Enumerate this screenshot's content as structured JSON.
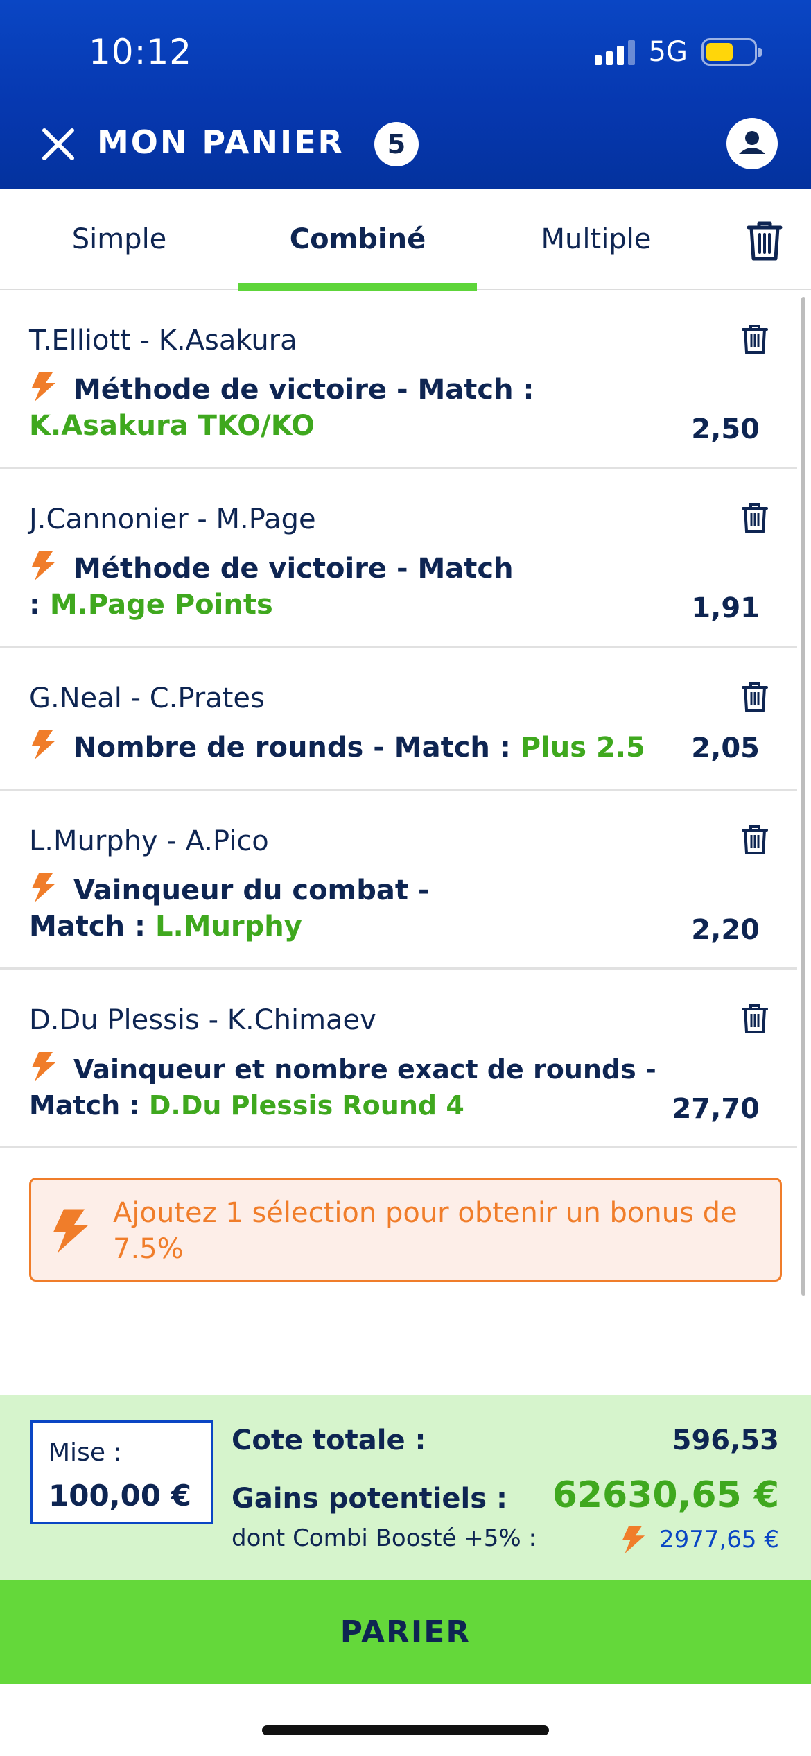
{
  "status_bar": {
    "time": "10:12",
    "network": "5G"
  },
  "header": {
    "title": "MON PANIER",
    "count": "5"
  },
  "tabs": [
    {
      "label": "Simple",
      "active": false
    },
    {
      "label": "Combiné",
      "active": true
    },
    {
      "label": "Multiple",
      "active": false
    }
  ],
  "bets": [
    {
      "match": "T.Elliott - K.Asakura",
      "market": "Méthode de victoire - Match : ",
      "selection": "K.Asakura TKO/KO",
      "odds": "2,50"
    },
    {
      "match": "J.Cannonier - M.Page",
      "market": "Méthode de victoire - Match : ",
      "selection": "M.Page Points",
      "odds": "1,91"
    },
    {
      "match": "G.Neal - C.Prates",
      "market": "Nombre de rounds - Match : ",
      "selection": "Plus 2.5",
      "odds": "2,05"
    },
    {
      "match": "L.Murphy - A.Pico",
      "market": "Vainqueur du combat - Match : ",
      "selection": "L.Murphy",
      "odds": "2,20"
    },
    {
      "match": "D.Du Plessis - K.Chimaev",
      "market": "Vainqueur et nombre exact de rounds - Match : ",
      "selection": "D.Du Plessis Round 4",
      "odds": "27,70"
    }
  ],
  "bonus_banner": {
    "text": "Ajoutez 1 sélection pour obtenir un bonus de 7.5%"
  },
  "summary": {
    "stake_label": "Mise :",
    "stake_value": "100,00 €",
    "total_odds_label": "Cote totale :",
    "total_odds": "596,53",
    "potential_gains_label": "Gains potentiels :",
    "potential_gains": "62630,65 €",
    "boost_label": "dont Combi Boosté +5% :",
    "boost_value": "2977,65 €"
  },
  "action": {
    "bet_button": "PARIER"
  },
  "colors": {
    "header_blue": "#0638b0",
    "accent_green": "#5ed53a",
    "selection_green": "#3fa81e",
    "bonus_orange": "#f07d2a",
    "navy_text": "#0e2552"
  },
  "icons": {
    "close": "close-icon",
    "avatar": "user-icon",
    "trash": "trash-icon",
    "bolt": "lightning-bolt-icon"
  }
}
